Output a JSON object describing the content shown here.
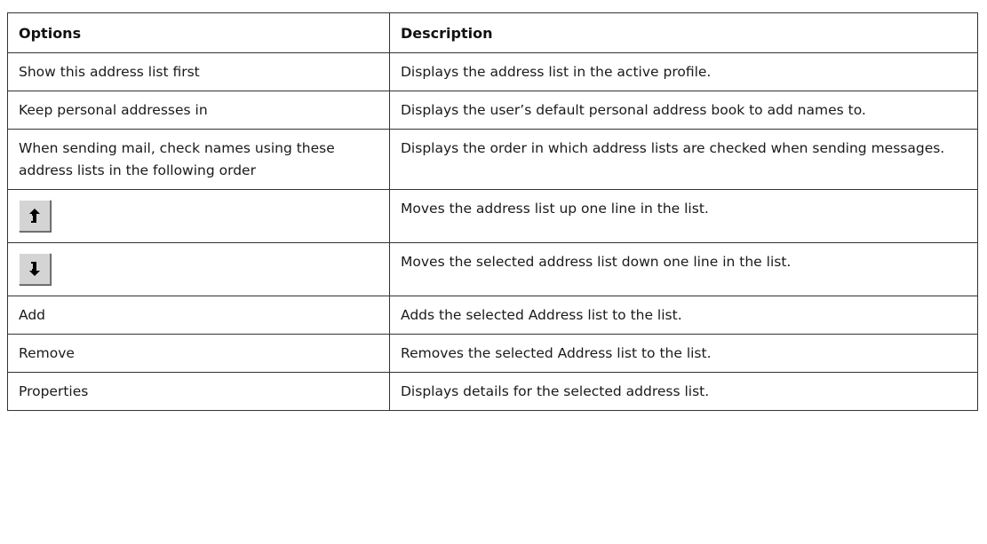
{
  "table": {
    "headers": {
      "options": "Options",
      "description": "Description"
    },
    "rows": [
      {
        "option": "Show this address list first",
        "description": "Displays the address list in the active profile."
      },
      {
        "option": "Keep personal addresses in",
        "description": "Displays the user’s default personal address book to add names to."
      },
      {
        "option": "When sending mail, check names using these address lists in the following order",
        "description": "Displays the order in which address lists are checked when sending messages."
      },
      {
        "option_icon": "move-up-arrow-icon",
        "description": "Moves the address list up one line in the list."
      },
      {
        "option_icon": "move-down-arrow-icon",
        "description": "Moves the selected address list down one line in the list."
      },
      {
        "option": "Add",
        "description": "Adds the selected Address list to the list."
      },
      {
        "option": "Remove",
        "description": "Removes the selected Address list to the list."
      },
      {
        "option": "Properties",
        "description": "Displays details for the selected address list."
      }
    ]
  },
  "colors": {
    "border": "#333333",
    "button_face": "#d4d4d4",
    "text": "#1a1a1a"
  }
}
